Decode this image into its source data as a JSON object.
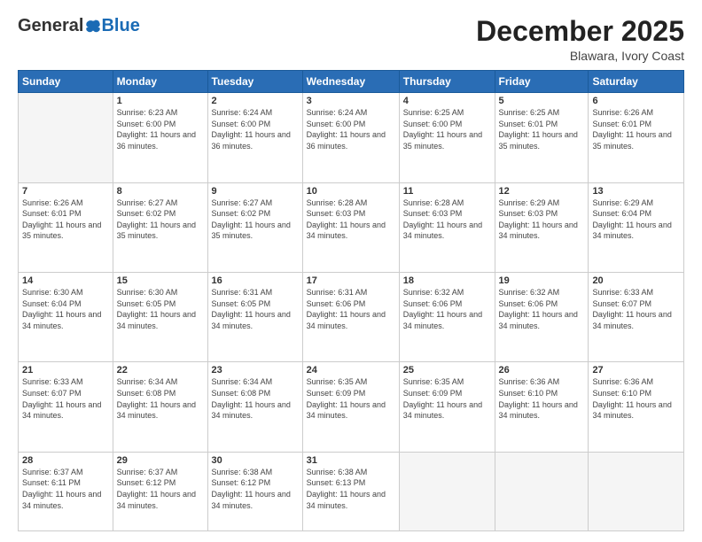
{
  "logo": {
    "general": "General",
    "blue": "Blue"
  },
  "header": {
    "month": "December 2025",
    "location": "Blawara, Ivory Coast"
  },
  "days_of_week": [
    "Sunday",
    "Monday",
    "Tuesday",
    "Wednesday",
    "Thursday",
    "Friday",
    "Saturday"
  ],
  "weeks": [
    [
      {
        "day": "",
        "info": ""
      },
      {
        "day": "1",
        "info": "Sunrise: 6:23 AM\nSunset: 6:00 PM\nDaylight: 11 hours and 36 minutes."
      },
      {
        "day": "2",
        "info": "Sunrise: 6:24 AM\nSunset: 6:00 PM\nDaylight: 11 hours and 36 minutes."
      },
      {
        "day": "3",
        "info": "Sunrise: 6:24 AM\nSunset: 6:00 PM\nDaylight: 11 hours and 36 minutes."
      },
      {
        "day": "4",
        "info": "Sunrise: 6:25 AM\nSunset: 6:00 PM\nDaylight: 11 hours and 35 minutes."
      },
      {
        "day": "5",
        "info": "Sunrise: 6:25 AM\nSunset: 6:01 PM\nDaylight: 11 hours and 35 minutes."
      },
      {
        "day": "6",
        "info": "Sunrise: 6:26 AM\nSunset: 6:01 PM\nDaylight: 11 hours and 35 minutes."
      }
    ],
    [
      {
        "day": "7",
        "info": "Sunrise: 6:26 AM\nSunset: 6:01 PM\nDaylight: 11 hours and 35 minutes."
      },
      {
        "day": "8",
        "info": "Sunrise: 6:27 AM\nSunset: 6:02 PM\nDaylight: 11 hours and 35 minutes."
      },
      {
        "day": "9",
        "info": "Sunrise: 6:27 AM\nSunset: 6:02 PM\nDaylight: 11 hours and 35 minutes."
      },
      {
        "day": "10",
        "info": "Sunrise: 6:28 AM\nSunset: 6:03 PM\nDaylight: 11 hours and 34 minutes."
      },
      {
        "day": "11",
        "info": "Sunrise: 6:28 AM\nSunset: 6:03 PM\nDaylight: 11 hours and 34 minutes."
      },
      {
        "day": "12",
        "info": "Sunrise: 6:29 AM\nSunset: 6:03 PM\nDaylight: 11 hours and 34 minutes."
      },
      {
        "day": "13",
        "info": "Sunrise: 6:29 AM\nSunset: 6:04 PM\nDaylight: 11 hours and 34 minutes."
      }
    ],
    [
      {
        "day": "14",
        "info": "Sunrise: 6:30 AM\nSunset: 6:04 PM\nDaylight: 11 hours and 34 minutes."
      },
      {
        "day": "15",
        "info": "Sunrise: 6:30 AM\nSunset: 6:05 PM\nDaylight: 11 hours and 34 minutes."
      },
      {
        "day": "16",
        "info": "Sunrise: 6:31 AM\nSunset: 6:05 PM\nDaylight: 11 hours and 34 minutes."
      },
      {
        "day": "17",
        "info": "Sunrise: 6:31 AM\nSunset: 6:06 PM\nDaylight: 11 hours and 34 minutes."
      },
      {
        "day": "18",
        "info": "Sunrise: 6:32 AM\nSunset: 6:06 PM\nDaylight: 11 hours and 34 minutes."
      },
      {
        "day": "19",
        "info": "Sunrise: 6:32 AM\nSunset: 6:06 PM\nDaylight: 11 hours and 34 minutes."
      },
      {
        "day": "20",
        "info": "Sunrise: 6:33 AM\nSunset: 6:07 PM\nDaylight: 11 hours and 34 minutes."
      }
    ],
    [
      {
        "day": "21",
        "info": "Sunrise: 6:33 AM\nSunset: 6:07 PM\nDaylight: 11 hours and 34 minutes."
      },
      {
        "day": "22",
        "info": "Sunrise: 6:34 AM\nSunset: 6:08 PM\nDaylight: 11 hours and 34 minutes."
      },
      {
        "day": "23",
        "info": "Sunrise: 6:34 AM\nSunset: 6:08 PM\nDaylight: 11 hours and 34 minutes."
      },
      {
        "day": "24",
        "info": "Sunrise: 6:35 AM\nSunset: 6:09 PM\nDaylight: 11 hours and 34 minutes."
      },
      {
        "day": "25",
        "info": "Sunrise: 6:35 AM\nSunset: 6:09 PM\nDaylight: 11 hours and 34 minutes."
      },
      {
        "day": "26",
        "info": "Sunrise: 6:36 AM\nSunset: 6:10 PM\nDaylight: 11 hours and 34 minutes."
      },
      {
        "day": "27",
        "info": "Sunrise: 6:36 AM\nSunset: 6:10 PM\nDaylight: 11 hours and 34 minutes."
      }
    ],
    [
      {
        "day": "28",
        "info": "Sunrise: 6:37 AM\nSunset: 6:11 PM\nDaylight: 11 hours and 34 minutes."
      },
      {
        "day": "29",
        "info": "Sunrise: 6:37 AM\nSunset: 6:12 PM\nDaylight: 11 hours and 34 minutes."
      },
      {
        "day": "30",
        "info": "Sunrise: 6:38 AM\nSunset: 6:12 PM\nDaylight: 11 hours and 34 minutes."
      },
      {
        "day": "31",
        "info": "Sunrise: 6:38 AM\nSunset: 6:13 PM\nDaylight: 11 hours and 34 minutes."
      },
      {
        "day": "",
        "info": ""
      },
      {
        "day": "",
        "info": ""
      },
      {
        "day": "",
        "info": ""
      }
    ]
  ]
}
